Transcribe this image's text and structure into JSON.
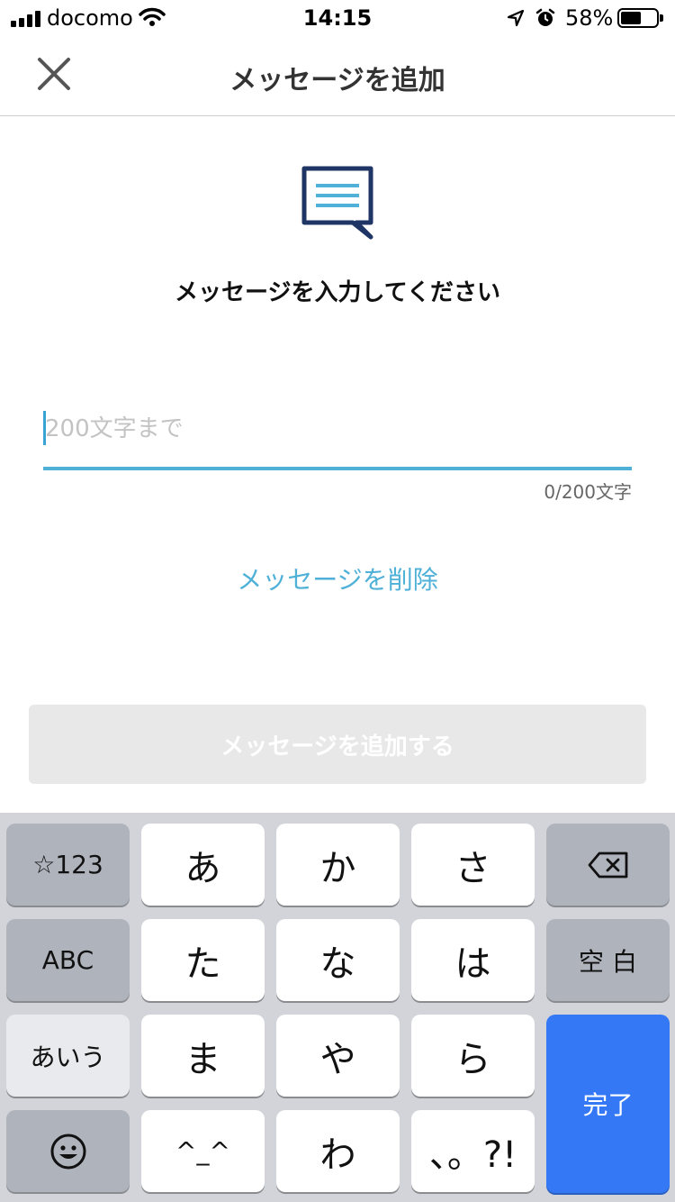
{
  "status_bar": {
    "carrier": "docomo",
    "time": "14:15",
    "battery_percent": "58%",
    "battery_level": 0.58,
    "icons": [
      "signal-icon",
      "wifi-icon",
      "location-icon",
      "alarm-icon",
      "battery-icon"
    ]
  },
  "header": {
    "close_icon": "close-icon",
    "title": "メッセージを追加"
  },
  "main": {
    "message_icon": "chat-bubble-icon",
    "prompt": "メッセージを入力してください",
    "input": {
      "value": "",
      "placeholder": "200文字まで"
    },
    "char_count": "0/200文字",
    "delete_link": "メッセージを削除",
    "submit_button": "メッセージを追加する"
  },
  "keyboard": {
    "row1": [
      "☆123",
      "あ",
      "か",
      "さ",
      "backspace-icon"
    ],
    "row2": [
      "ABC",
      "た",
      "な",
      "は",
      "空 白"
    ],
    "row3": [
      "あいう",
      "ま",
      "や",
      "ら",
      "完了"
    ],
    "row4": [
      "emoji-icon",
      "^_^",
      "わ",
      "、。?!"
    ],
    "colors": {
      "function_key": "#aeb3bc",
      "done_key": "#3478f6",
      "background": "#d2d4d9"
    }
  },
  "colors": {
    "accent": "#4fb0d8",
    "icon_navy": "#1f3566",
    "disabled_button": "#e8e8e8"
  }
}
